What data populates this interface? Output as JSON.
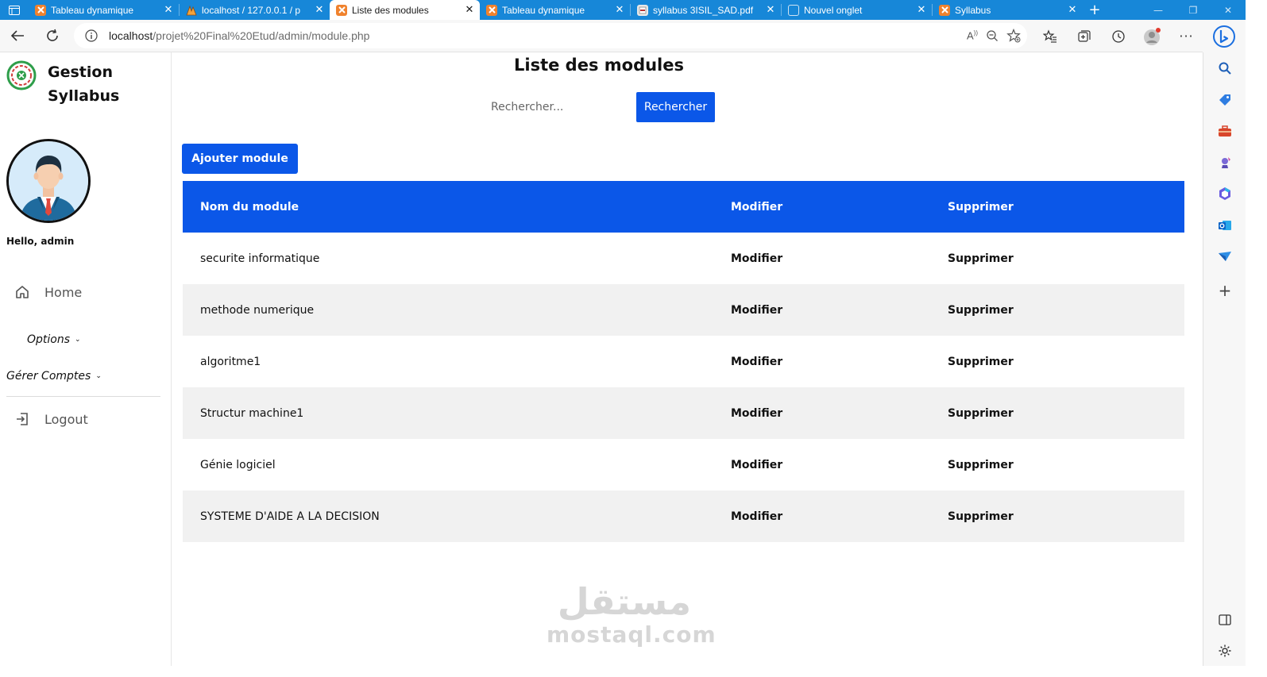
{
  "browser": {
    "tabs": [
      {
        "label": "Tableau dynamique",
        "icon": "xampp-icon",
        "active": false
      },
      {
        "label": "localhost / 127.0.0.1 / p",
        "icon": "phpmyadmin-icon",
        "active": false
      },
      {
        "label": "Liste des modules",
        "icon": "xampp-icon",
        "active": true
      },
      {
        "label": "Tableau dynamique",
        "icon": "xampp-icon",
        "active": false
      },
      {
        "label": "syllabus 3ISIL_SAD.pdf",
        "icon": "pdf-icon",
        "active": false
      },
      {
        "label": "Nouvel onglet",
        "icon": "blank-page-icon",
        "active": false
      },
      {
        "label": "Syllabus",
        "icon": "xampp-icon",
        "active": false
      }
    ],
    "url_host": "localhost",
    "url_path": "/projet%20Final%20Etud/admin/module.php",
    "accent": "#1787d8"
  },
  "sidebar": {
    "brand_title": "Gestion Syllabus",
    "greeting": "Hello, admin",
    "home_label": "Home",
    "options_label": "Options",
    "comptes_label": "Gérer Comptes",
    "logout_label": "Logout"
  },
  "main": {
    "title": "Liste des modules",
    "search_placeholder": "Rechercher...",
    "search_button": "Rechercher",
    "add_button": "Ajouter module",
    "primary_color": "#0b57e8",
    "table": {
      "headers": [
        "Nom du module",
        "Modifier",
        "Supprimer"
      ],
      "rows": [
        {
          "name": "securite informatique",
          "edit": "Modifier",
          "delete": "Supprimer"
        },
        {
          "name": "methode numerique",
          "edit": "Modifier",
          "delete": "Supprimer"
        },
        {
          "name": "algoritme1",
          "edit": "Modifier",
          "delete": "Supprimer"
        },
        {
          "name": "Structur machine1",
          "edit": "Modifier",
          "delete": "Supprimer"
        },
        {
          "name": "Génie logiciel",
          "edit": "Modifier",
          "delete": "Supprimer"
        },
        {
          "name": "SYSTEME D'AIDE A LA DECISION",
          "edit": "Modifier",
          "delete": "Supprimer"
        }
      ]
    },
    "watermark_ar": "مستقل",
    "watermark_latin": "mostaql.com"
  }
}
